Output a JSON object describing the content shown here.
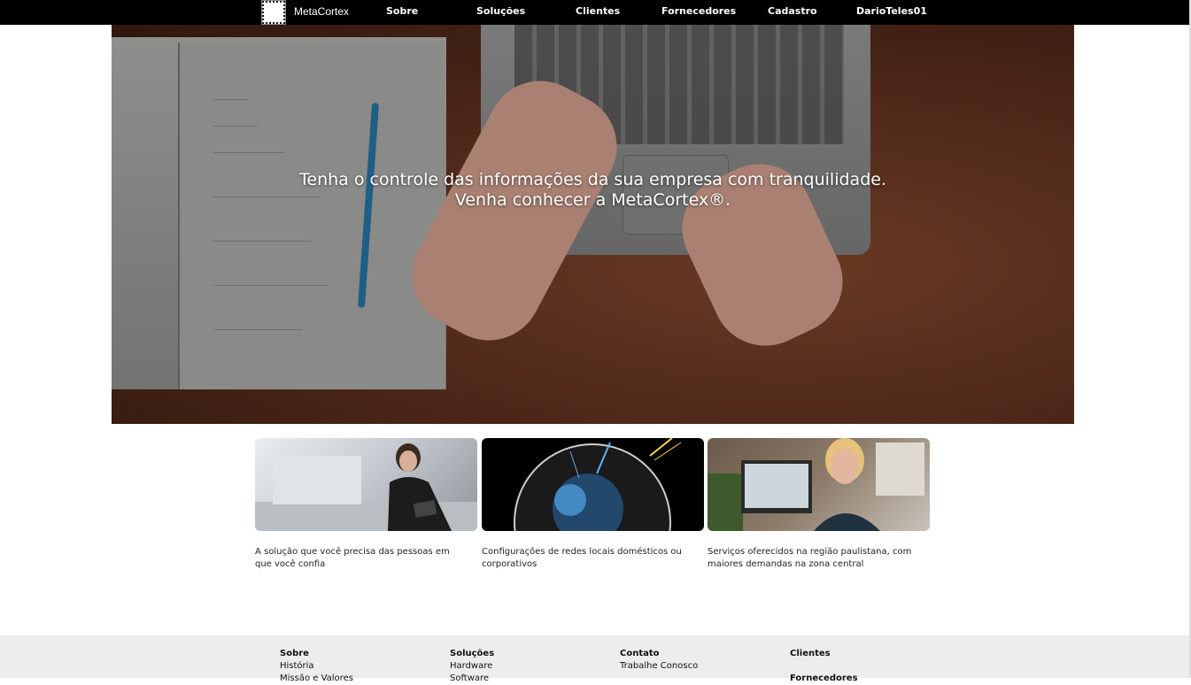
{
  "header": {
    "brand": "MetaCortex",
    "nav": [
      "Sobre",
      "Soluções",
      "Clientes",
      "Fornecedores",
      "Cadastro",
      "DarioTeles01"
    ]
  },
  "hero": {
    "line1": "Tenha o controle das informações da sua empresa com tranquilidade.",
    "line2": "Venha conhecer a MetaCortex®."
  },
  "cards": [
    {
      "image": "woman-with-tablet-photo",
      "text": "A solução que você precisa das pessoas em que você confia"
    },
    {
      "image": "globe-network-photo",
      "text": "Configurações de redes locais domésticos ou corporativos"
    },
    {
      "image": "woman-at-computer-photo",
      "text": "Serviços oferecidos na região paulistana, com maiores demandas na zona central"
    }
  ],
  "footer": {
    "columns": [
      {
        "title": "Sobre",
        "items": [
          "História",
          "Missão e Valores"
        ]
      },
      {
        "title": "Soluções",
        "items": [
          "Hardware",
          "Software"
        ]
      },
      {
        "title": "Contato",
        "items": [
          "Trabalhe Conosco"
        ]
      },
      {
        "title": "Clientes",
        "items": [
          "",
          "Fornecedores"
        ]
      }
    ]
  },
  "colors": {
    "topbar": "#000000",
    "footer": "#ededed",
    "hero_wood": "#4a2618"
  }
}
